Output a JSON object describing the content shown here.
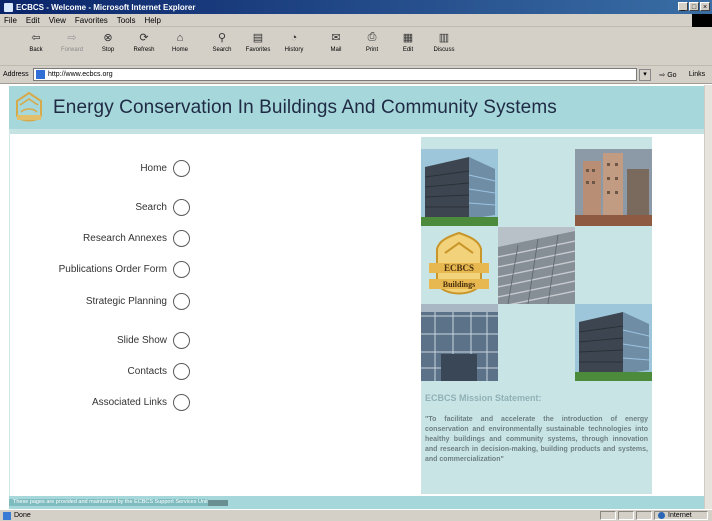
{
  "window": {
    "title": "ECBCS - Welcome - Microsoft Internet Explorer"
  },
  "menu": [
    "File",
    "Edit",
    "View",
    "Favorites",
    "Tools",
    "Help"
  ],
  "toolbar": [
    {
      "label": "Back",
      "icon": "back-arrow-icon",
      "disabled": false
    },
    {
      "label": "Forward",
      "icon": "forward-arrow-icon",
      "disabled": true
    },
    {
      "label": "Stop",
      "icon": "stop-icon",
      "disabled": false
    },
    {
      "label": "Refresh",
      "icon": "refresh-icon",
      "disabled": false
    },
    {
      "label": "Home",
      "icon": "home-icon",
      "disabled": false
    },
    {
      "label": "Search",
      "icon": "search-icon",
      "disabled": false
    },
    {
      "label": "Favorites",
      "icon": "favorites-icon",
      "disabled": false
    },
    {
      "label": "History",
      "icon": "history-icon",
      "disabled": false
    },
    {
      "label": "Mail",
      "icon": "mail-icon",
      "disabled": false
    },
    {
      "label": "Print",
      "icon": "print-icon",
      "disabled": false
    },
    {
      "label": "Edit",
      "icon": "edit-icon",
      "disabled": false
    },
    {
      "label": "Discuss",
      "icon": "discuss-icon",
      "disabled": false
    }
  ],
  "address": {
    "label": "Address",
    "url": "http://www.ecbcs.org",
    "go_label": "Go",
    "links_label": "Links"
  },
  "site": {
    "title": "Energy Conservation In Buildings And Community Systems"
  },
  "nav": [
    "Home",
    "Search",
    "Research Annexes",
    "Publications Order Form",
    "Strategic Planning",
    "Slide Show",
    "Contacts",
    "Associated Links"
  ],
  "logo_tile": {
    "line1": "ECBCS",
    "line2": "Buildings"
  },
  "mission": {
    "heading": "ECBCS Mission Statement:",
    "text": "\"To facilitate and accelerate the introduction of energy conservation and environmentally sustainable technologies into healthy buildings and community systems, through innovation and research in decision-making, building products and systems, and commercialization\""
  },
  "footer": {
    "text": "These pages are provided and maintained by the ECBCS Support Services Unit"
  },
  "status": {
    "text": "Done",
    "zone": "Internet"
  },
  "colors": {
    "banner": "#a6d7da",
    "panel": "#c9e4e5",
    "title_text": "#1f2a44",
    "titlebar": "#0a246a"
  }
}
